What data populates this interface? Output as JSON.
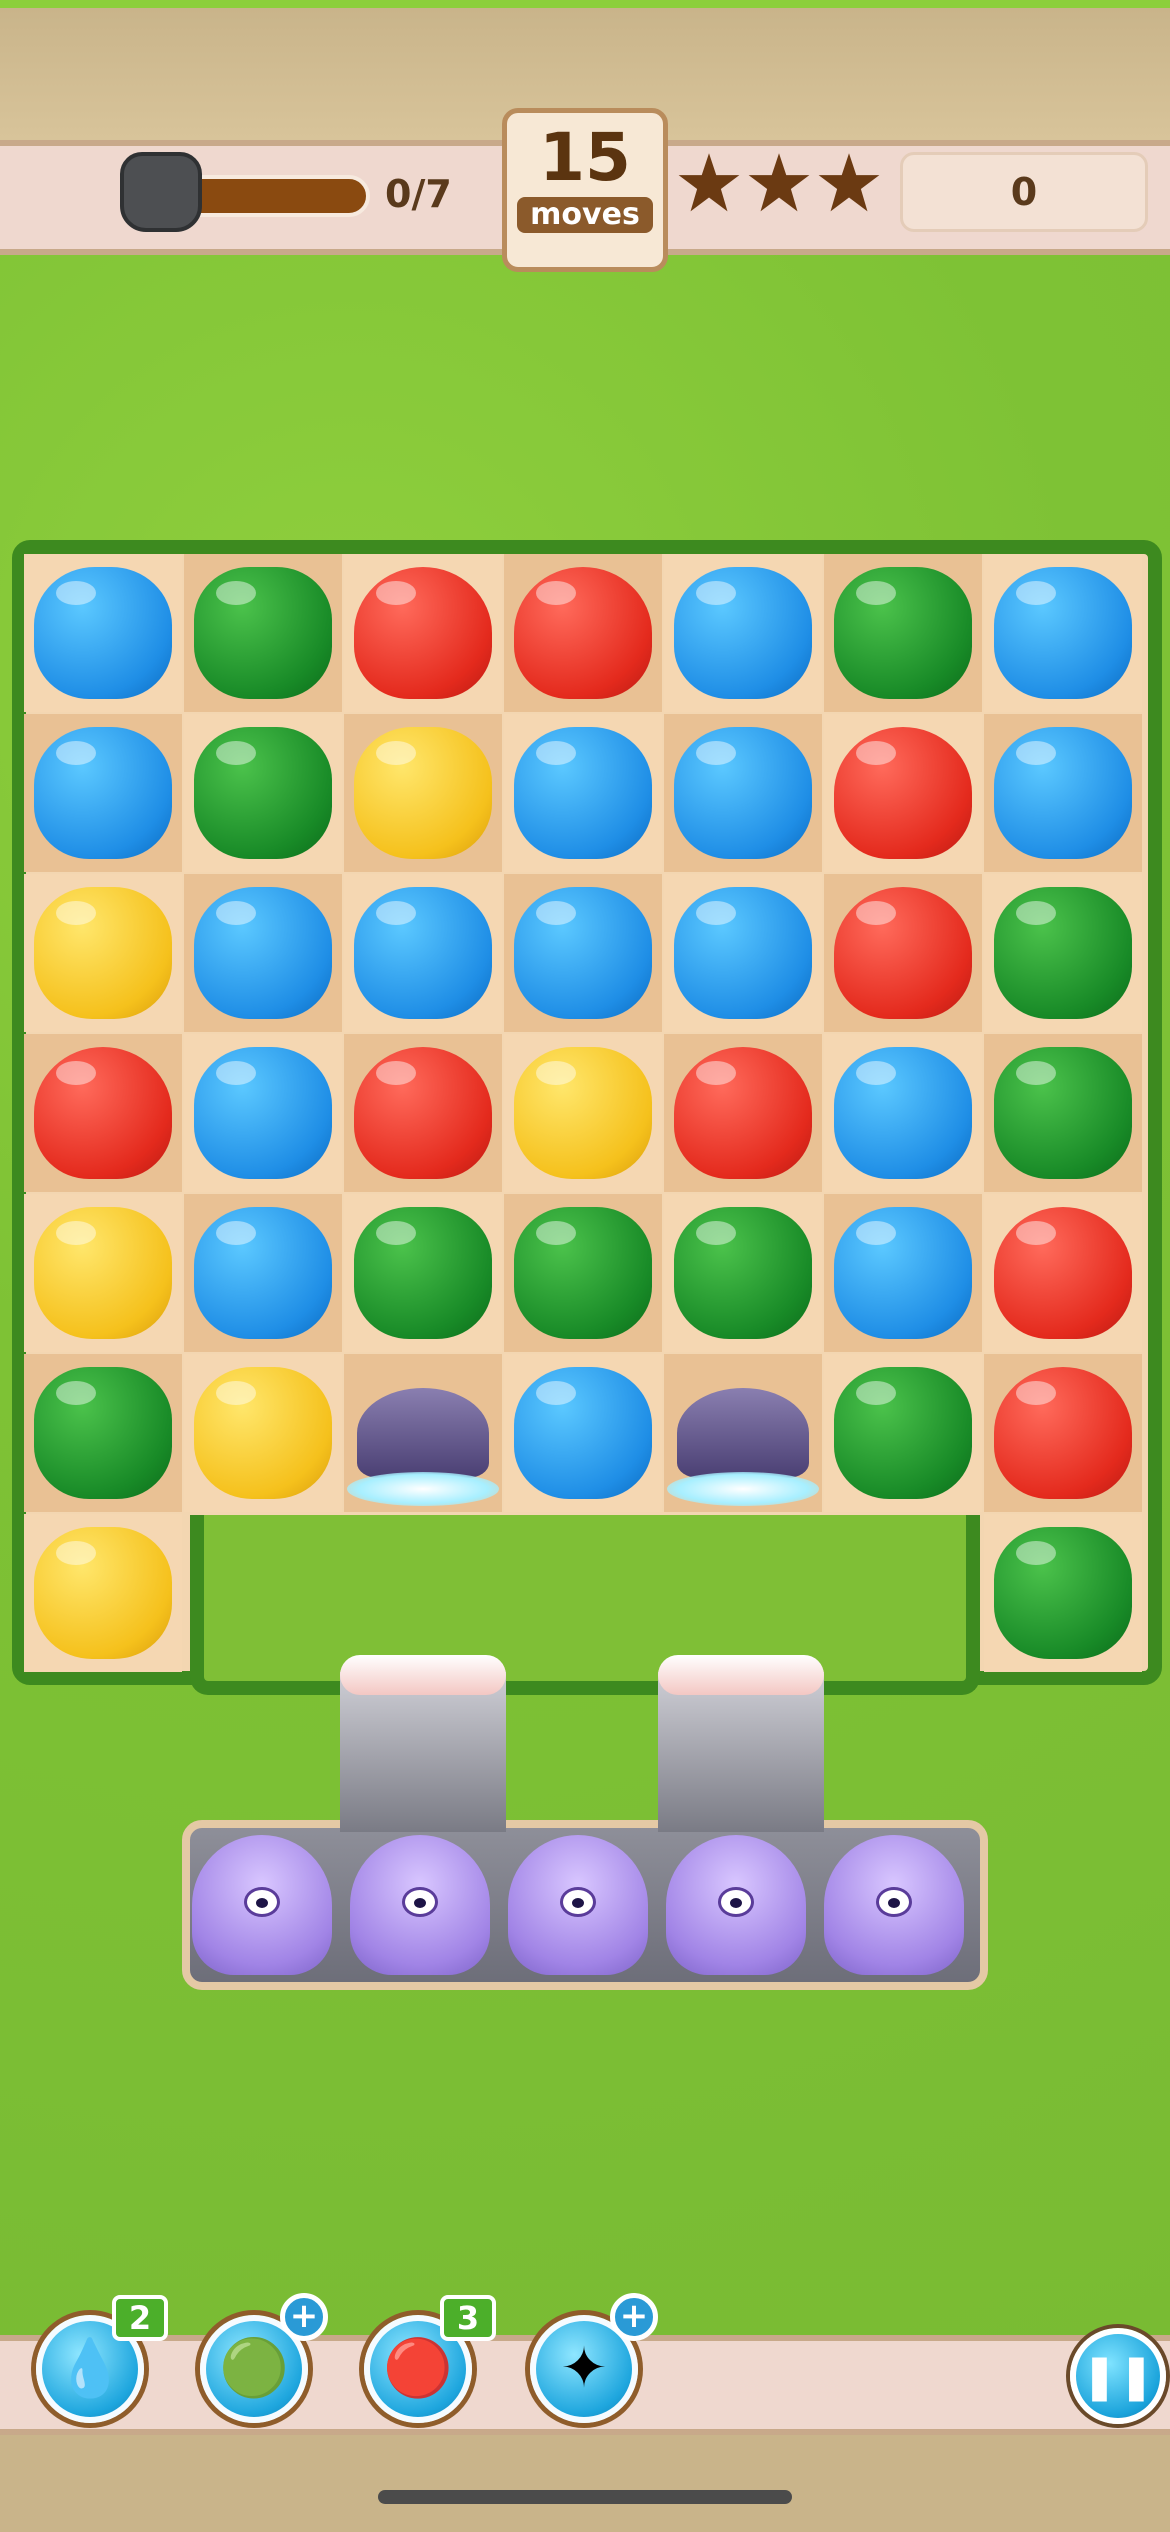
{
  "hud": {
    "progress_text": "0/7",
    "progress_fraction": 0,
    "moves_count": "15",
    "moves_label": "moves",
    "stars_earned": 0,
    "stars_total": 3,
    "score": "0"
  },
  "board": {
    "rows": [
      [
        "blue",
        "green",
        "red",
        "red",
        "blue",
        "green",
        "blue"
      ],
      [
        "blue",
        "green",
        "yellow",
        "blue",
        "blue",
        "red",
        "blue"
      ],
      [
        "yellow",
        "blue",
        "blue",
        "blue",
        "blue",
        "red",
        "green"
      ],
      [
        "red",
        "blue",
        "red",
        "yellow",
        "red",
        "blue",
        "green"
      ],
      [
        "yellow",
        "blue",
        "green",
        "green",
        "green",
        "blue",
        "red"
      ],
      [
        "green",
        "yellow",
        "shell",
        "blue",
        "shell",
        "green",
        "red"
      ],
      [
        "yellow",
        "empty",
        "empty",
        "empty",
        "empty",
        "empty",
        "green"
      ]
    ]
  },
  "creatures": {
    "count": 5
  },
  "boosters": [
    {
      "icon": "water-drop-icon",
      "badge": "2",
      "badge_type": "count"
    },
    {
      "icon": "paint-jelly-icon",
      "badge": "+",
      "badge_type": "add"
    },
    {
      "icon": "rainbow-jelly-icon",
      "badge": "3",
      "badge_type": "count"
    },
    {
      "icon": "star-sparkle-icon",
      "badge": "+",
      "badge_type": "add"
    }
  ],
  "pause_icon": "pause-icon",
  "colors": {
    "grass": "#7fbf36",
    "hedge": "#3d8a1f",
    "blue": "#1f8ee6",
    "green": "#188a27",
    "red": "#e42a1d",
    "yellow": "#f5c11c"
  }
}
